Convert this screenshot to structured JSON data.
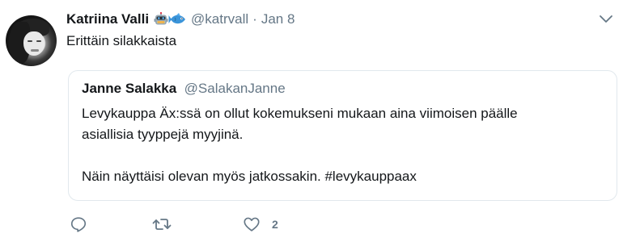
{
  "tweet": {
    "author_name": "Katriina Valli",
    "author_handle": "@katrvall",
    "separator": "·",
    "timestamp": "Jan 8",
    "emojis": [
      "robot-face-emoji",
      "fish-emoji"
    ],
    "text": "Erittäin silakkaista"
  },
  "quoted_tweet": {
    "author_name": "Janne Salakka",
    "author_handle": "@SalakanJanne",
    "lines": [
      "Levykauppa Äx:ssä on ollut kokemukseni mukaan aina viimoisen päälle",
      "asiallisia tyyppejä myyjinä."
    ],
    "last_line": "Näin näyttäisi olevan myös jatkossakin. #levykauppaax"
  },
  "actions": {
    "reply_icon": "reply-icon",
    "retweet_icon": "retweet-icon",
    "like_icon": "heart-icon",
    "like_count": "2"
  },
  "colors": {
    "text": "#14171a",
    "secondary": "#657786",
    "border": "#e1e8ed"
  }
}
